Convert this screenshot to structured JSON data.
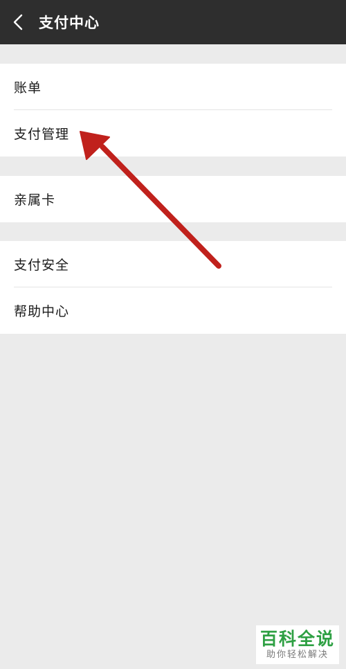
{
  "header": {
    "title": "支付中心",
    "back_icon": "chevron-left-icon"
  },
  "groups": [
    {
      "items": [
        {
          "label": "账单"
        },
        {
          "label": "支付管理"
        }
      ]
    },
    {
      "items": [
        {
          "label": "亲属卡"
        }
      ]
    },
    {
      "items": [
        {
          "label": "支付安全"
        },
        {
          "label": "帮助中心"
        }
      ]
    }
  ],
  "annotation": {
    "color": "#c0211c",
    "points_to": "支付管理"
  },
  "watermark": {
    "title": "百科全说",
    "subtitle": "助你轻松解决",
    "color": "#2ea043"
  },
  "colors": {
    "header_bg": "#2e2e2e",
    "page_bg": "#ebebeb",
    "row_bg": "#ffffff"
  }
}
